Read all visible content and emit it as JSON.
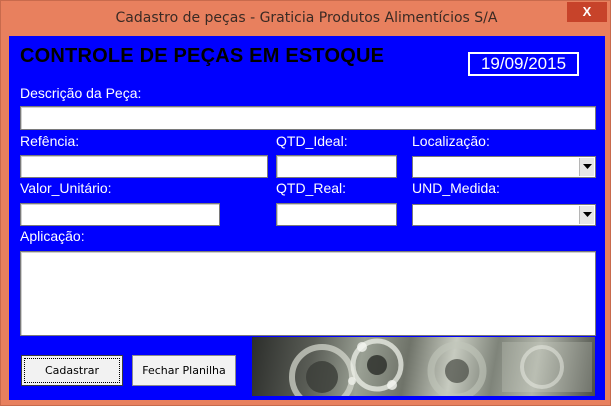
{
  "window": {
    "title": "Cadastro de peças - Graticia Produtos Alimentícios S/A",
    "close_label": "X"
  },
  "header": {
    "heading": "CONTROLE DE PEÇAS EM ESTOQUE",
    "date": "19/09/2015"
  },
  "fields": {
    "descricao_label": "Descrição da Peça:",
    "descricao_value": "",
    "referencia_label": "Refência:",
    "referencia_value": "",
    "qtd_ideal_label": "QTD_Ideal:",
    "qtd_ideal_value": "",
    "localizacao_label": "Localização:",
    "localizacao_value": "",
    "valor_unitario_label": "Valor_Unitário:",
    "valor_unitario_value": "",
    "qtd_real_label": "QTD_Real:",
    "qtd_real_value": "",
    "und_medida_label": "UND_Medida:",
    "und_medida_value": "",
    "aplicacao_label": "Aplicação:",
    "aplicacao_value": ""
  },
  "buttons": {
    "cadastrar": "Cadastrar",
    "fechar": "Fechar Planilha"
  },
  "colors": {
    "form_background": "#0000ff",
    "window_frame": "#e8805e",
    "close_button": "#c7432a"
  },
  "images": {
    "decorative_photo": "bearings-machinery-photo"
  }
}
